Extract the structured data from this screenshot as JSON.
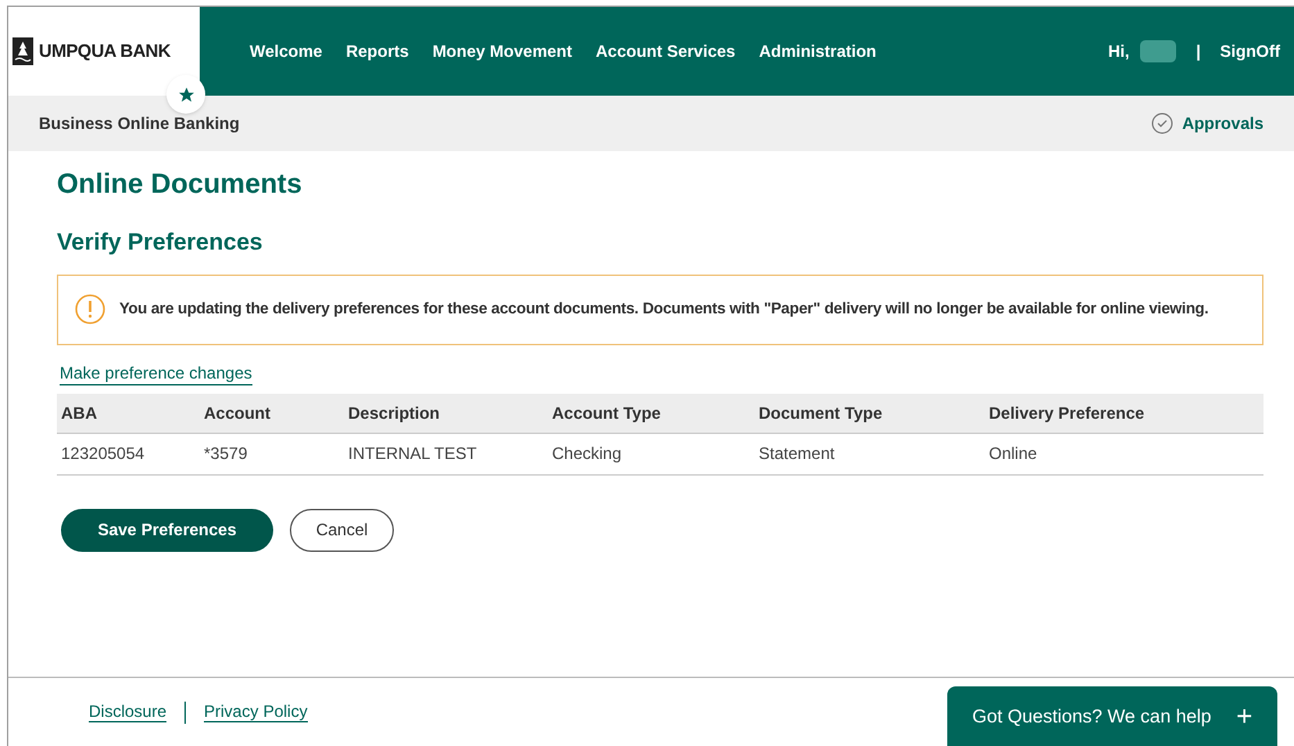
{
  "brand": {
    "name": "UMPQUA BANK"
  },
  "nav": [
    {
      "label": "Welcome"
    },
    {
      "label": "Reports"
    },
    {
      "label": "Money Movement"
    },
    {
      "label": "Account Services"
    },
    {
      "label": "Administration"
    }
  ],
  "user": {
    "greeting": "Hi,",
    "separator": "|",
    "signoff": "SignOff"
  },
  "subbar": {
    "title": "Business Online Banking",
    "approvals": "Approvals"
  },
  "page": {
    "title": "Online Documents",
    "subtitle": "Verify Preferences"
  },
  "alert": {
    "text": "You are updating the delivery preferences for these account documents. Documents with \"Paper\" delivery will no longer be available for online viewing."
  },
  "link": "Make preference changes",
  "table": {
    "columns": [
      "ABA",
      "Account",
      "Description",
      "Account Type",
      "Document Type",
      "Delivery Preference"
    ],
    "rows": [
      [
        "123205054",
        "*3579",
        "INTERNAL TEST",
        "Checking",
        "Statement",
        "Online"
      ]
    ]
  },
  "buttons": [
    {
      "label": "Save Preferences",
      "kind": "primary"
    },
    {
      "label": "Cancel",
      "kind": "secondary"
    }
  ],
  "footer": {
    "links": [
      "Disclosure",
      "Privacy Policy"
    ]
  },
  "help": {
    "label": "Got Questions? We can help",
    "icon": "+"
  }
}
